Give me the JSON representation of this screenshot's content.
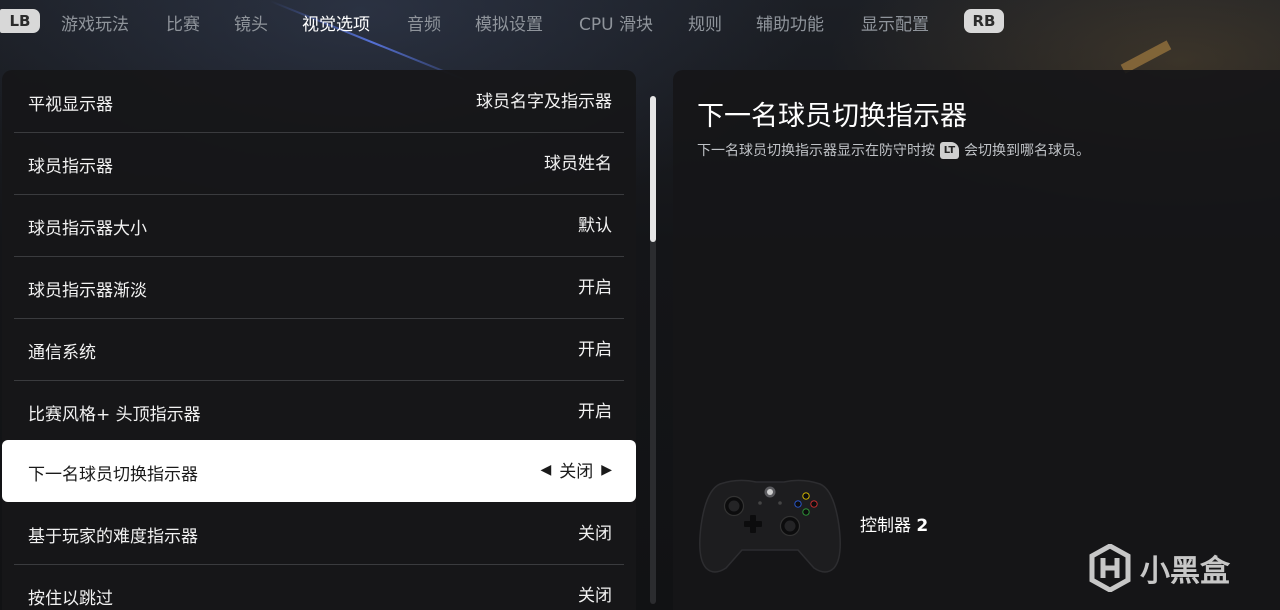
{
  "tabs": {
    "lb": "LB",
    "rb": "RB",
    "items": [
      "游戏玩法",
      "比赛",
      "镜头",
      "视觉选项",
      "音频",
      "模拟设置",
      "CPU 滑块",
      "规则",
      "辅助功能",
      "显示配置"
    ],
    "active": "视觉选项"
  },
  "settings": [
    {
      "label": "平视显示器",
      "value": "球员名字及指示器"
    },
    {
      "label": "球员指示器",
      "value": "球员姓名"
    },
    {
      "label": "球员指示器大小",
      "value": "默认"
    },
    {
      "label": "球员指示器渐淡",
      "value": "开启"
    },
    {
      "label": "通信系统",
      "value": "开启"
    },
    {
      "label": "比赛风格+ 头顶指示器",
      "value": "开启"
    },
    {
      "label": "下一名球员切换指示器",
      "value": "关闭"
    },
    {
      "label": "基于玩家的难度指示器",
      "value": "关闭"
    },
    {
      "label": "按住以跳过",
      "value": "关闭"
    }
  ],
  "detail": {
    "title": "下一名球员切换指示器",
    "desc_before": "下一名球员切换指示器显示在防守时按",
    "button": "LT",
    "desc_after": "会切换到哪名球员。"
  },
  "controller": {
    "label": "控制器",
    "number": "2"
  },
  "watermark": {
    "text": "小黑盒"
  }
}
